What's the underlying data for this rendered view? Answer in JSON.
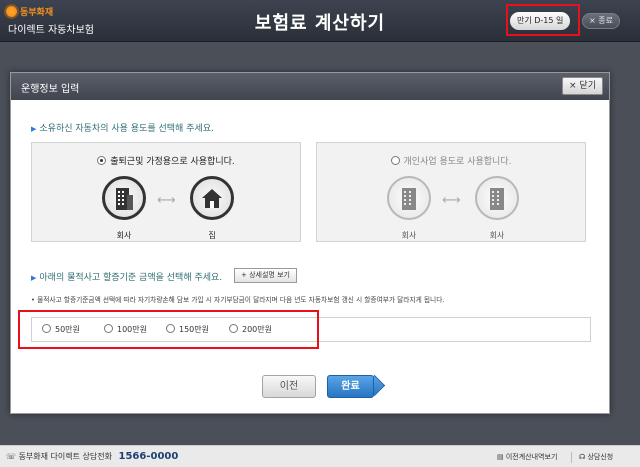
{
  "header": {
    "brand_name": "동부화재",
    "brand_sub": "다이렉트 자동차보험",
    "title": "보험료 계산하기",
    "countdown": "만기 D-15 일",
    "exit_label": "× 종료"
  },
  "dialog": {
    "title": "운행정보 입력",
    "close_label": "× 닫기",
    "question1": "소유하신 자동차의 사용 용도를 선택해 주세요.",
    "usage_options": [
      {
        "label": "출퇴근및 가정용으로 사용합니다.",
        "selected": true,
        "from": "회사",
        "to": "집"
      },
      {
        "label": "개인사업 용도로 사용합니다.",
        "selected": false,
        "from": "회사",
        "to": "회사"
      }
    ],
    "question2": "아래의 물적사고 할증기준 금액을 선택해 주세요.",
    "detail_button": "+ 상세설명 보기",
    "note": "• 물적사고 할증기준금액 선택에 따라 자기차량손해 담보 가입 시 자기부담금이 달라지며 다음 년도 자동차보험 갱신 시 할증여부가 달라지게 됩니다.",
    "amounts": [
      "50만원",
      "100만원",
      "150만원",
      "200만원"
    ],
    "prev_label": "이전",
    "ok_label": "완료"
  },
  "footer": {
    "phone_label": "동부화재 다이렉트 상담전화",
    "phone_number": "1566-0000",
    "history_link": "이전계산내역보기",
    "consult_link": "상담신청"
  },
  "colors": {
    "accent": "#2674c4",
    "highlight_border": "#e8101a",
    "brand": "#f6931e"
  }
}
